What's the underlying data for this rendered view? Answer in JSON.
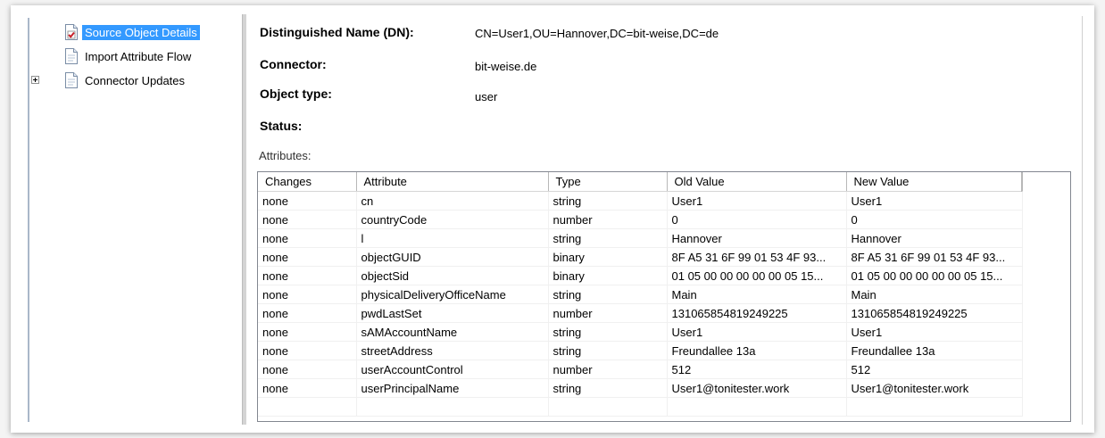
{
  "tree": {
    "items": [
      {
        "label": "Source Object Details",
        "selected": true,
        "icon": "checked-document-icon"
      },
      {
        "label": "Import Attribute Flow",
        "selected": false,
        "icon": "document-icon"
      },
      {
        "label": "Connector Updates",
        "selected": false,
        "icon": "document-icon",
        "expandable": true
      }
    ]
  },
  "details": {
    "dn_label": "Distinguished Name (DN):",
    "dn_value": "CN=User1,OU=Hannover,DC=bit-weise,DC=de",
    "connector_label": "Connector:",
    "connector_value": "bit-weise.de",
    "object_type_label": "Object type:",
    "object_type_value": "user",
    "status_label": "Status:"
  },
  "attributes": {
    "caption": "Attributes:",
    "columns": [
      "Changes",
      "Attribute",
      "Type",
      "Old Value",
      "New Value"
    ],
    "rows": [
      [
        "none",
        "cn",
        "string",
        "User1",
        "User1"
      ],
      [
        "none",
        "countryCode",
        "number",
        "0",
        "0"
      ],
      [
        "none",
        "l",
        "string",
        "Hannover",
        "Hannover"
      ],
      [
        "none",
        "objectGUID",
        "binary",
        "8F A5 31 6F 99 01 53 4F 93...",
        "8F A5 31 6F 99 01 53 4F 93..."
      ],
      [
        "none",
        "objectSid",
        "binary",
        "01 05 00 00 00 00 00 05 15...",
        "01 05 00 00 00 00 00 05 15..."
      ],
      [
        "none",
        "physicalDeliveryOfficeName",
        "string",
        "Main",
        "Main"
      ],
      [
        "none",
        "pwdLastSet",
        "number",
        "131065854819249225",
        "131065854819249225"
      ],
      [
        "none",
        "sAMAccountName",
        "string",
        "User1",
        "User1"
      ],
      [
        "none",
        "streetAddress",
        "string",
        "Freundallee 13a",
        "Freundallee 13a"
      ],
      [
        "none",
        "userAccountControl",
        "number",
        "512",
        "512"
      ],
      [
        "none",
        "userPrincipalName",
        "string",
        "User1@tonitester.work",
        "User1@tonitester.work"
      ]
    ]
  },
  "colors": {
    "selection": "#3399ff",
    "border": "#828790"
  }
}
